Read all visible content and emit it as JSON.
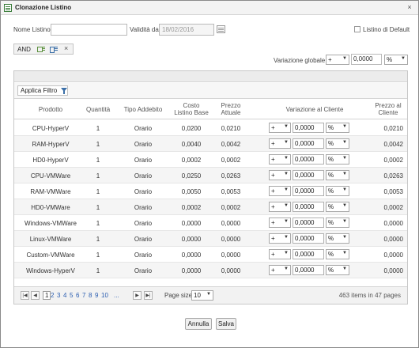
{
  "window": {
    "title": "Clonazione Listino",
    "close_label": "×"
  },
  "form": {
    "name_label": "Nome Listino",
    "name_value": "",
    "date_label": "Validità da",
    "date_value": "18/02/2016",
    "default_label": "Listino di Default",
    "default_checked": false
  },
  "filter": {
    "and_label": "AND",
    "clear_label": "×"
  },
  "global_variation": {
    "label": "Variazione globale",
    "sign": "+",
    "value": "0,0000",
    "unit": "%"
  },
  "grid": {
    "apply_filter_label": "Applica Filtro",
    "columns": [
      "Prodotto",
      "Quantità",
      "Tipo Addebito",
      "Costo Listino Base",
      "Prezzo Attuale",
      "Variazione al Cliente",
      "Prezzo al Cliente"
    ],
    "rows": [
      {
        "product": "CPU-HyperV",
        "qty": "1",
        "type": "Orario",
        "base": "0,0200",
        "current": "0,0210",
        "sign": "+",
        "variation": "0,0000",
        "unit": "%",
        "client": "0,0210"
      },
      {
        "product": "RAM-HyperV",
        "qty": "1",
        "type": "Orario",
        "base": "0,0040",
        "current": "0,0042",
        "sign": "+",
        "variation": "0,0000",
        "unit": "%",
        "client": "0,0042"
      },
      {
        "product": "HD0-HyperV",
        "qty": "1",
        "type": "Orario",
        "base": "0,0002",
        "current": "0,0002",
        "sign": "+",
        "variation": "0,0000",
        "unit": "%",
        "client": "0,0002"
      },
      {
        "product": "CPU-VMWare",
        "qty": "1",
        "type": "Orario",
        "base": "0,0250",
        "current": "0,0263",
        "sign": "+",
        "variation": "0,0000",
        "unit": "%",
        "client": "0,0263"
      },
      {
        "product": "RAM-VMWare",
        "qty": "1",
        "type": "Orario",
        "base": "0,0050",
        "current": "0,0053",
        "sign": "+",
        "variation": "0,0000",
        "unit": "%",
        "client": "0,0053"
      },
      {
        "product": "HD0-VMWare",
        "qty": "1",
        "type": "Orario",
        "base": "0,0002",
        "current": "0,0002",
        "sign": "+",
        "variation": "0,0000",
        "unit": "%",
        "client": "0,0002"
      },
      {
        "product": "Windows-VMWare",
        "qty": "1",
        "type": "Orario",
        "base": "0,0000",
        "current": "0,0000",
        "sign": "+",
        "variation": "0,0000",
        "unit": "%",
        "client": "0,0000"
      },
      {
        "product": "Linux-VMWare",
        "qty": "1",
        "type": "Orario",
        "base": "0,0000",
        "current": "0,0000",
        "sign": "+",
        "variation": "0,0000",
        "unit": "%",
        "client": "0,0000"
      },
      {
        "product": "Custom-VMWare",
        "qty": "1",
        "type": "Orario",
        "base": "0,0000",
        "current": "0,0000",
        "sign": "+",
        "variation": "0,0000",
        "unit": "%",
        "client": "0,0000"
      },
      {
        "product": "Windows-HyperV",
        "qty": "1",
        "type": "Orario",
        "base": "0,0000",
        "current": "0,0000",
        "sign": "+",
        "variation": "0,0000",
        "unit": "%",
        "client": "0,0000"
      }
    ]
  },
  "pager": {
    "first": "|◀",
    "prev": "◀",
    "next": "▶",
    "last": "▶|",
    "pages": [
      "1",
      "2",
      "3",
      "4",
      "5",
      "6",
      "7",
      "8",
      "9",
      "10",
      "..."
    ],
    "current_page": "1",
    "page_size_label": "Page size:",
    "page_size": "10",
    "info": "463 items in 47 pages"
  },
  "buttons": {
    "cancel": "Annulla",
    "save": "Salva"
  }
}
